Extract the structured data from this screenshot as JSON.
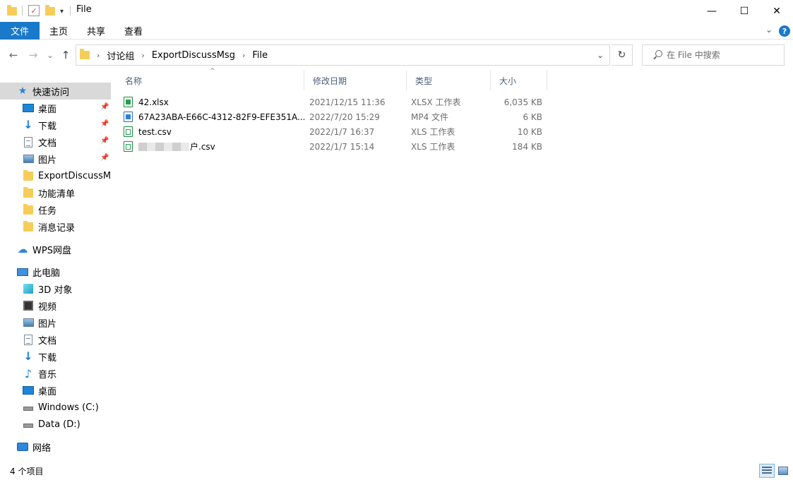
{
  "window": {
    "title": "File",
    "minimize": "—",
    "maximize": "☐",
    "close": "✕"
  },
  "ribbon": {
    "file_tab": "文件",
    "tabs": [
      "主页",
      "共享",
      "查看"
    ],
    "help": "?"
  },
  "navigation": {
    "back": "←",
    "forward": "→",
    "recent": "⌄",
    "up": "↑",
    "breadcrumb": [
      "讨论组",
      "ExportDiscussMsg",
      "File"
    ],
    "search_placeholder": "在 File 中搜索"
  },
  "sidebar": {
    "quick_access": "快速访问",
    "quick_items": [
      "桌面",
      "下载",
      "文档",
      "图片",
      "ExportDiscussMsg",
      "功能清单",
      "任务",
      "消息记录"
    ],
    "wps": "WPS网盘",
    "this_pc": "此电脑",
    "pc_items": [
      "3D 对象",
      "视频",
      "图片",
      "文档",
      "下载",
      "音乐",
      "桌面",
      "Windows (C:)",
      "Data (D:)"
    ],
    "network": "网络"
  },
  "columns": {
    "name": "名称",
    "date": "修改日期",
    "type": "类型",
    "size": "大小"
  },
  "files": [
    {
      "name": "42.xlsx",
      "date": "2021/12/15 11:36",
      "type": "XLSX 工作表",
      "size": "6,035 KB",
      "icon": "xlsx-file-icon"
    },
    {
      "name": "67A23ABA-E66C-4312-82F9-EFE351A...",
      "date": "2022/7/20 15:29",
      "type": "MP4 文件",
      "size": "6 KB",
      "icon": "mp4-file-icon"
    },
    {
      "name": "test.csv",
      "date": "2022/1/7 16:37",
      "type": "XLS 工作表",
      "size": "10 KB",
      "icon": "csv-file-icon"
    },
    {
      "name": "户.csv",
      "date": "2022/1/7 15:14",
      "type": "XLS 工作表",
      "size": "184 KB",
      "icon": "csv-file-icon"
    }
  ],
  "status": {
    "item_count": "4 个项目"
  }
}
